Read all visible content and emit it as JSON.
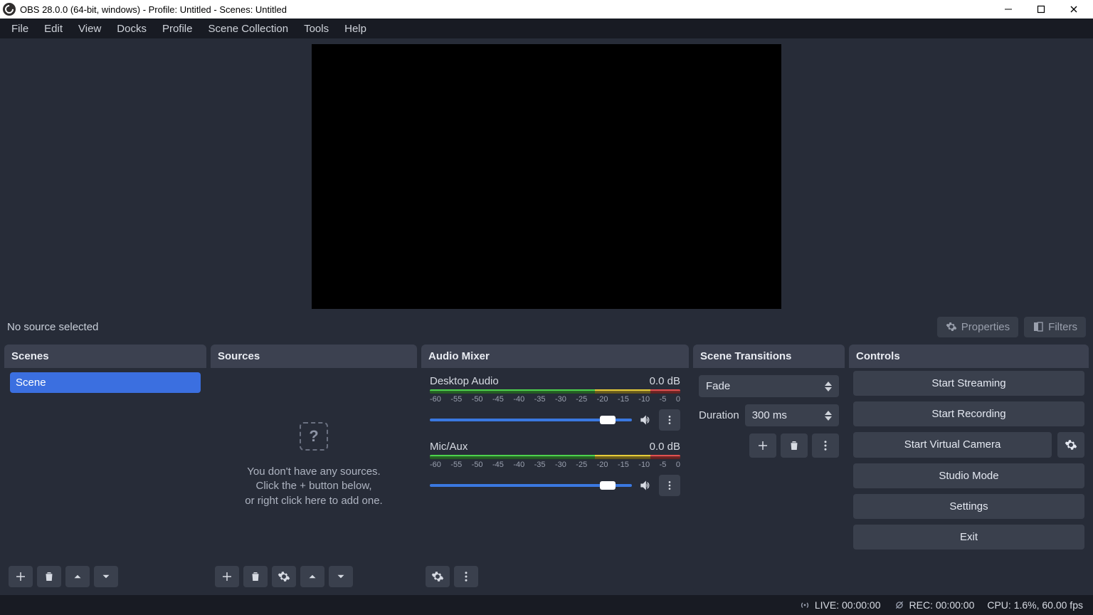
{
  "titlebar": {
    "title": "OBS 28.0.0 (64-bit, windows) - Profile: Untitled - Scenes: Untitled"
  },
  "menu": {
    "items": [
      "File",
      "Edit",
      "View",
      "Docks",
      "Profile",
      "Scene Collection",
      "Tools",
      "Help"
    ]
  },
  "preview_toolbar": {
    "status": "No source selected",
    "properties": "Properties",
    "filters": "Filters"
  },
  "scenes": {
    "title": "Scenes",
    "items": [
      "Scene"
    ]
  },
  "sources": {
    "title": "Sources",
    "empty1": "You don't have any sources.",
    "empty2": "Click the + button below,",
    "empty3": "or right click here to add one."
  },
  "mixer": {
    "title": "Audio Mixer",
    "ticks": [
      "-60",
      "-55",
      "-50",
      "-45",
      "-40",
      "-35",
      "-30",
      "-25",
      "-20",
      "-15",
      "-10",
      "-5",
      "0"
    ],
    "items": [
      {
        "name": "Desktop Audio",
        "db": "0.0 dB"
      },
      {
        "name": "Mic/Aux",
        "db": "0.0 dB"
      }
    ]
  },
  "transitions": {
    "title": "Scene Transitions",
    "selected": "Fade",
    "duration_label": "Duration",
    "duration_value": "300 ms"
  },
  "controls": {
    "title": "Controls",
    "start_streaming": "Start Streaming",
    "start_recording": "Start Recording",
    "start_virtual_cam": "Start Virtual Camera",
    "studio_mode": "Studio Mode",
    "settings": "Settings",
    "exit": "Exit"
  },
  "status": {
    "live": "LIVE: 00:00:00",
    "rec": "REC: 00:00:00",
    "cpu": "CPU: 1.6%, 60.00 fps"
  }
}
